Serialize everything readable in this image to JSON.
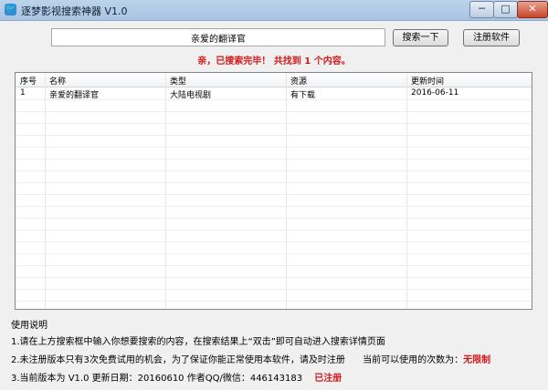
{
  "window": {
    "title": "逐梦影视搜索神器 V1.0",
    "app_icon": "bird-icon",
    "controls": {
      "minimize": "─",
      "maximize": "□",
      "close": "✕"
    }
  },
  "search": {
    "value": "亲爱的翻译官",
    "search_button": "搜索一下",
    "register_button": "注册软件"
  },
  "status_message": "亲，已搜索完毕！ 共找到 1 个内容。",
  "table": {
    "columns": [
      "序号",
      "名称",
      "类型",
      "资源",
      "更新时间"
    ],
    "rows": [
      [
        "1",
        "亲爱的翻译官",
        "大陆电视剧",
        "有下载",
        "2016-06-11"
      ]
    ]
  },
  "usage": {
    "title": "使用说明",
    "line1": "1.请在上方搜索框中输入你想要搜索的内容，在搜索结果上“双击”即可自动进入搜索详情页面",
    "line2": "2.未注册版本只有3次免费试用的机会，为了保证你能正常使用本软件，请及时注册",
    "line2_count_label": "当前可以使用的次数为：",
    "line2_count_value": "无限制",
    "line3": "3.当前版本为 V1.0 更新日期：20160610 作者QQ/微信：446143183",
    "line3_status": "已注册"
  },
  "colors": {
    "accent_red": "#d11a1a",
    "titlebar": "#bcd3ec"
  }
}
